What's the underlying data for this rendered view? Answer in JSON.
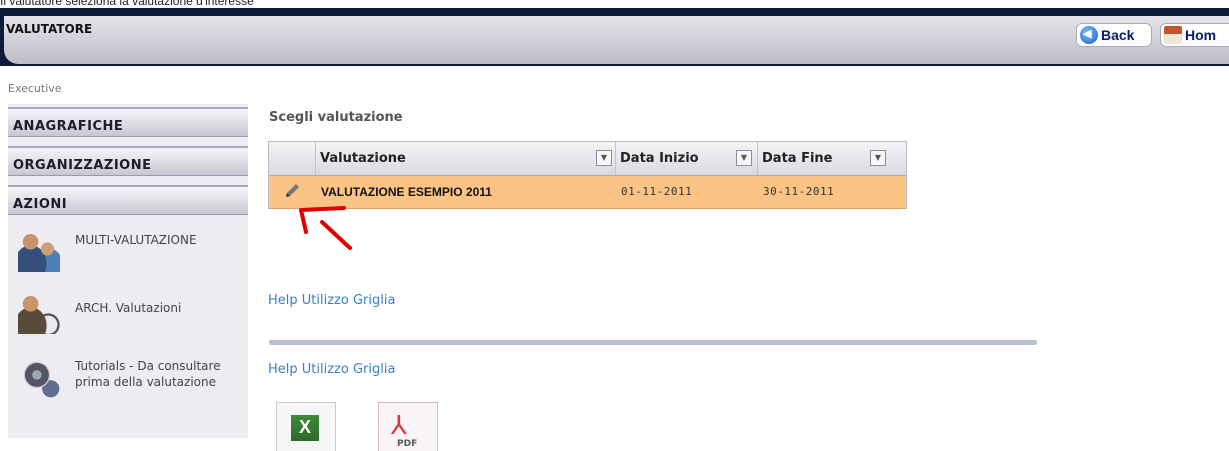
{
  "caption": "Il valutatore seleziona la valutazione d'interesse",
  "header": {
    "title": "VALUTATORE",
    "back_label": "Back",
    "home_label": "Hom"
  },
  "breadcrumb": "Executive",
  "sidebar": {
    "sections": [
      {
        "label": "ANAGRAFICHE"
      },
      {
        "label": "ORGANIZZAZIONE"
      },
      {
        "label": "AZIONI"
      }
    ],
    "items": [
      {
        "label": "MULTI-VALUTAZIONE",
        "icon": "users-icon"
      },
      {
        "label": "ARCH. Valutazioni",
        "icon": "users-clock-icon"
      },
      {
        "label_line1": "Tutorials - Da consultare",
        "label_line2": "prima della valutazione",
        "icon": "film-reel-help-icon"
      }
    ]
  },
  "main": {
    "section_title": "Scegli valutazione",
    "grid": {
      "columns": [
        "Valutazione",
        "Data Inizio",
        "Data Fine"
      ],
      "rows": [
        {
          "valutazione": "VALUTAZIONE ESEMPIO 2011",
          "data_inizio": "01-11-2011",
          "data_fine": "30-11-2011"
        }
      ],
      "selected_row_color": "#fcc484"
    },
    "help_link_1": "Help Utilizzo Griglia",
    "help_link_2": "Help Utilizzo Griglia",
    "exports": [
      {
        "icon": "excel-icon"
      },
      {
        "icon": "pdf-icon",
        "label": "PDF"
      }
    ]
  },
  "annotation": {
    "color": "#e00000"
  }
}
